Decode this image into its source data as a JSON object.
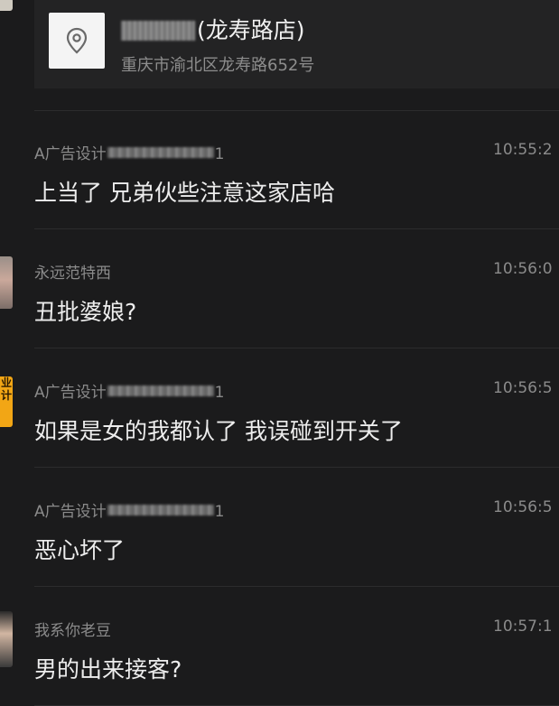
{
  "location_card": {
    "title_suffix": "(龙寿路店)",
    "address": "重庆市渝北区龙寿路652号",
    "icon": "location-pin-icon"
  },
  "edge_avatars": [
    {
      "name": "avatar-top-partial"
    },
    {
      "name": "avatar-yongyuan"
    },
    {
      "name": "avatar-ad-design",
      "text": "业计"
    },
    {
      "name": "avatar-laodou"
    }
  ],
  "messages": [
    {
      "sender": "A广告设计",
      "sender_suffix": "1",
      "redacted": true,
      "time": "10:55:2",
      "text": "上当了 兄弟伙些注意这家店哈"
    },
    {
      "sender": "永远范特西",
      "sender_suffix": "",
      "redacted": false,
      "time": "10:56:0",
      "text": "丑批婆娘?"
    },
    {
      "sender": "A广告设计",
      "sender_suffix": "1",
      "redacted": true,
      "time": "10:56:5",
      "text": "如果是女的我都认了 我误碰到开关了"
    },
    {
      "sender": "A广告设计",
      "sender_suffix": "1",
      "redacted": true,
      "time": "10:56:5",
      "text": "恶心坏了"
    },
    {
      "sender": "我系你老豆",
      "sender_suffix": "",
      "redacted": false,
      "time": "10:57:1",
      "text": "男的出来接客?"
    }
  ]
}
